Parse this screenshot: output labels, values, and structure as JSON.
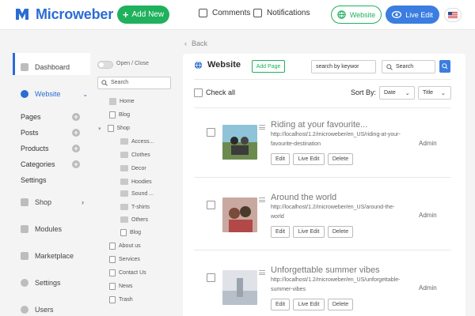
{
  "brand": {
    "name": "Microweber"
  },
  "topbar": {
    "add_new": "Add New",
    "comments": "Comments",
    "notifications": "Notifications",
    "website": "Website",
    "live_edit": "Live Edit"
  },
  "sidebar": {
    "dashboard": "Dashboard",
    "website": "Website",
    "pages": "Pages",
    "posts": "Posts",
    "products": "Products",
    "categories": "Categories",
    "settings_sub": "Settings",
    "shop": "Shop",
    "modules": "Modules",
    "marketplace": "Marketplace",
    "settings": "Settings",
    "users": "Users"
  },
  "tree": {
    "toggle_label": "Open / Close",
    "search_placeholder": "Search",
    "nodes": [
      "Home",
      "Blog",
      "Shop",
      "Access...",
      "Clothes",
      "Decor",
      "Hoodies",
      "Sound ...",
      "T-shirts",
      "Others",
      "Blog",
      "About us",
      "Services",
      "Contact Us",
      "News",
      "Trash"
    ]
  },
  "main": {
    "back": "Back",
    "title": "Website",
    "add_page": "Add Page",
    "search_by": "search by keywor",
    "search_placeholder": "Search",
    "check_all": "Check all",
    "sort_by": "Sort By:",
    "sort_date": "Date",
    "sort_title": "Title"
  },
  "posts": [
    {
      "title": "Riding at your favourite...",
      "url": "http://localhost/1.2/microweber/en_US/riding-at-your-favourite-destination",
      "author": "Admin"
    },
    {
      "title": "Around the world",
      "url": "http://localhost/1.2/microweber/en_US/around-the-world",
      "author": "Admin"
    },
    {
      "title": "Unforgettable summer vibes",
      "url": "http://localhost/1.2/microweber/en_US/unforgettable-summer-vibes",
      "author": "Admin"
    }
  ],
  "post_buttons": {
    "edit": "Edit",
    "live_edit": "Live Edit",
    "delete": "Delete"
  },
  "colors": {
    "accent_blue": "#3b7de0",
    "accent_green": "#1fb15c",
    "brand_blue": "#2b6cd4"
  },
  "icons": [
    "logo-icon",
    "comments-icon",
    "notifications-icon",
    "globe-icon",
    "eye-icon",
    "flag-icon",
    "search-icon",
    "chevron-down-icon",
    "plus-icon",
    "folder-icon",
    "page-icon"
  ]
}
